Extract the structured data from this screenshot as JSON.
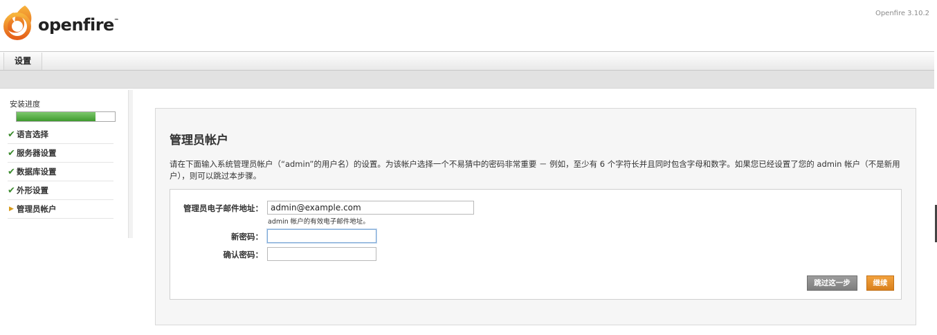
{
  "app": {
    "logo_text": "openfire",
    "logo_tm": "™",
    "version": "Openfire 3.10.2"
  },
  "tabs": [
    {
      "label": "设置"
    }
  ],
  "sidebar": {
    "progress_label": "安装进度",
    "progress_fraction": 0.8,
    "steps": [
      {
        "label": "语言选择",
        "status": "done"
      },
      {
        "label": "服务器设置",
        "status": "done"
      },
      {
        "label": "数据库设置",
        "status": "done"
      },
      {
        "label": "外形设置",
        "status": "done"
      },
      {
        "label": "管理员帐户",
        "status": "current"
      }
    ]
  },
  "main": {
    "title": "管理员帐户",
    "description": "请在下面输入系统管理员帐户（“admin”的用户名）的设置。为该帐户选择一个不易猜中的密码非常重要 － 例如，至少有 6 个字符长并且同时包含字母和数字。如果您已经设置了您的 admin 帐户（不是新用户），则可以跳过本步骤。",
    "form": {
      "email_label": "管理员电子邮件地址：",
      "email_value": "admin@example.com",
      "email_hint": "admin 帐户的有效电子邮件地址。",
      "password_label": "新密码：",
      "password_value": "",
      "confirm_label": "确认密码：",
      "confirm_value": ""
    },
    "buttons": {
      "skip": "跳过这一步",
      "continue": "继续"
    }
  },
  "colors": {
    "progress_fill": "#4ea83c",
    "continue_button": "#e3901f",
    "skip_button": "#8c8c8c",
    "logo_orange": "#f07c1a"
  }
}
